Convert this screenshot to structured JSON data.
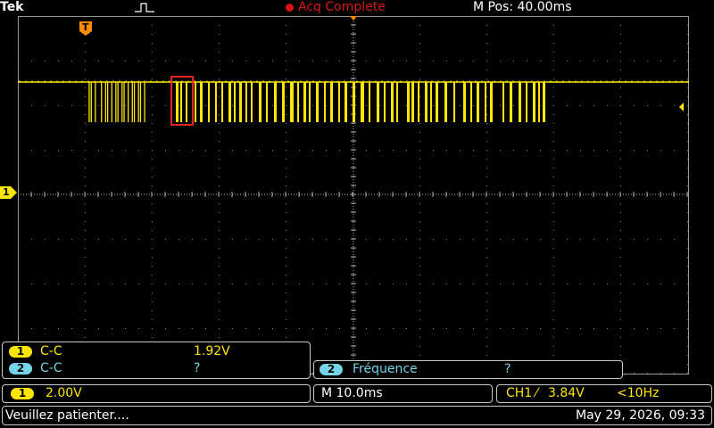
{
  "header": {
    "brand": "Tek",
    "acq_status": "Acq Complete",
    "position": "M Pos: 40.00ms"
  },
  "markers": {
    "ch1_level": "1",
    "trigger_position": "T"
  },
  "measurements": {
    "row1": {
      "channel": "1",
      "name": "C-C",
      "value": "1.92V"
    },
    "row2": {
      "channel": "2",
      "name": "C-C",
      "value": "?"
    },
    "freq": {
      "channel": "2",
      "name": "Fréquence",
      "value": "?"
    }
  },
  "channel_scale": {
    "channel": "1",
    "value": "2.00V"
  },
  "timebase": "M 10.0ms",
  "trigger": {
    "source": "CH1",
    "slope": "⁄",
    "level": "3.84V",
    "frequency": "<10Hz"
  },
  "status": {
    "message": "Veuillez patienter....",
    "datetime": "May 29, 2026, 09:33"
  },
  "colors": {
    "ch1": "#ffe600",
    "ch2": "#74d4e8",
    "acq": "#d81818",
    "grid": "#8a8a8a",
    "cursor_box": "#e0281e"
  }
}
